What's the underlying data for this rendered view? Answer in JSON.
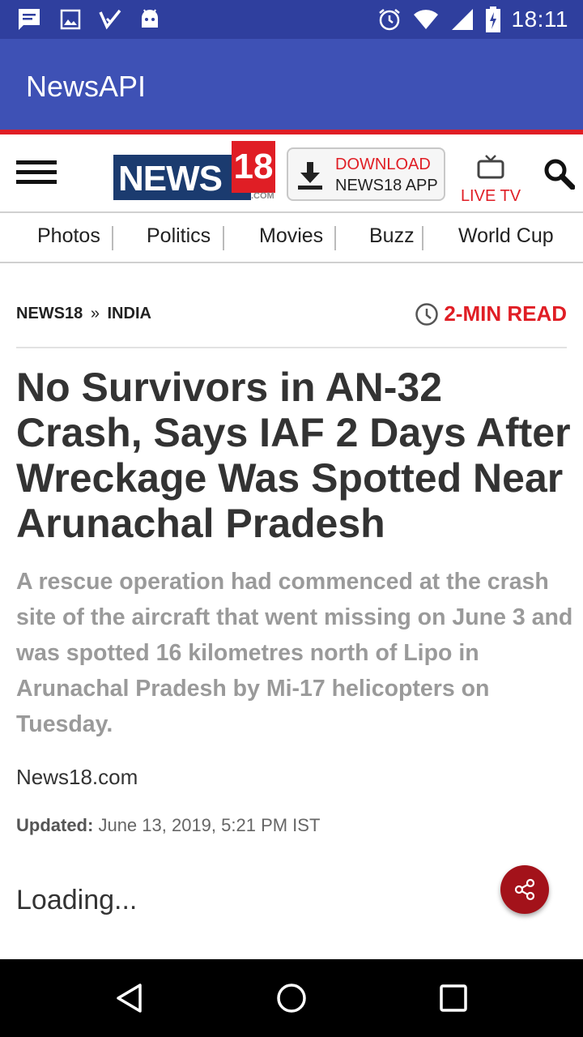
{
  "status_bar": {
    "time": "18:11",
    "left_icons": [
      "message-icon",
      "image-icon",
      "checkmark-icon",
      "android-icon"
    ],
    "right_icons": [
      "alarm-icon",
      "wifi-icon",
      "signal-icon",
      "battery-icon"
    ]
  },
  "app_bar": {
    "title": "NewsAPI"
  },
  "site_header": {
    "logo_text": "NEWS",
    "logo_number": "18",
    "logo_suffix": ".COM",
    "download_line1": "DOWNLOAD",
    "download_line2": "NEWS18 APP",
    "live_tv": "LIVE TV"
  },
  "categories": [
    "Photos",
    "Politics",
    "Movies",
    "Buzz",
    "World Cup"
  ],
  "article": {
    "breadcrumb_site": "NEWS18",
    "breadcrumb_sep": "»",
    "breadcrumb_section": "INDIA",
    "read_time": "2-MIN READ",
    "headline": "No Survivors in AN-32 Crash, Says IAF 2 Days After Wreckage Was Spotted Near Arunachal Pradesh",
    "summary": "A rescue operation had commenced at the crash site of the aircraft that went missing on June 3 and was spotted 16 kilometres north of Lipo in Arunachal Pradesh by Mi-17 helicopters on Tuesday.",
    "source": "News18.com",
    "updated_label": "Updated:",
    "updated_value": "June 13, 2019, 5:21 PM IST",
    "loading": "Loading..."
  },
  "colors": {
    "status_bar": "#2f3f9e",
    "app_bar": "#3e51b5",
    "accent_red": "#e01e25",
    "logo_blue": "#1b3b6f",
    "share_button": "#a3121a"
  }
}
